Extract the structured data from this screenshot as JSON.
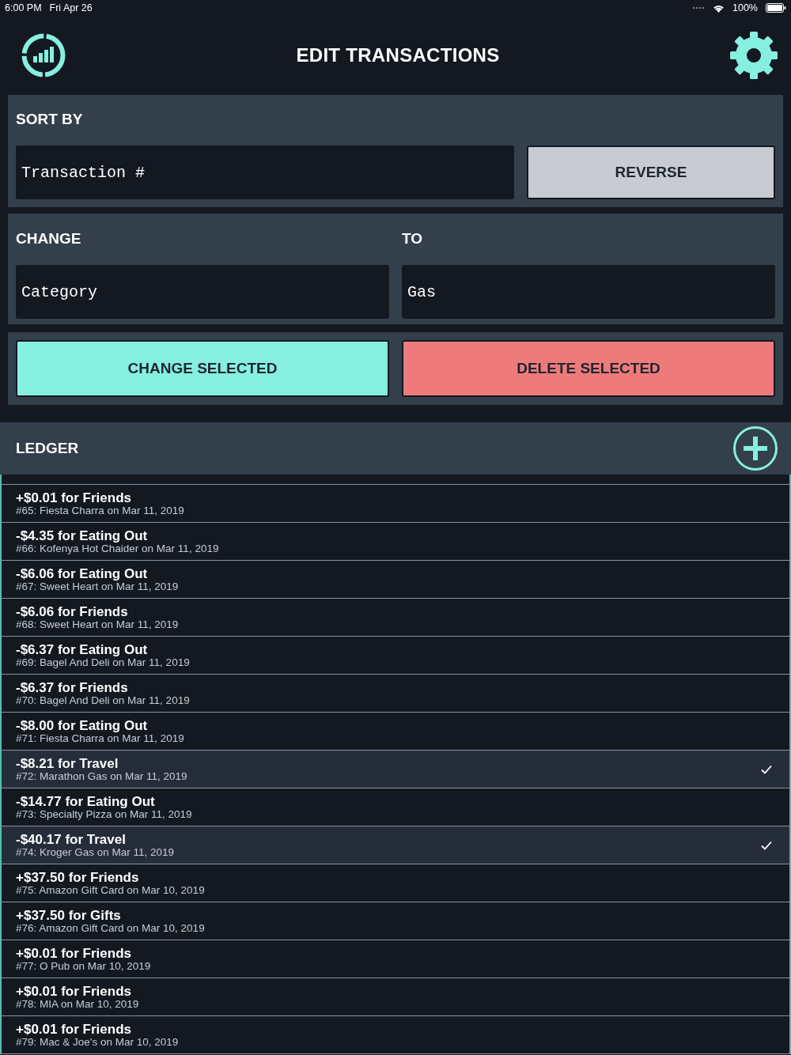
{
  "status_bar": {
    "time": "6:00 PM",
    "date": "Fri Apr 26",
    "battery": "100%"
  },
  "header": {
    "title": "EDIT TRANSACTIONS"
  },
  "sort": {
    "label": "SORT BY",
    "value": "Transaction #",
    "button": "REVERSE"
  },
  "change": {
    "label": "CHANGE",
    "field": "Category",
    "to_label": "TO",
    "to_value": "Gas"
  },
  "actions": [
    {
      "kind": "change",
      "label": "CHANGE SELECTED"
    },
    {
      "kind": "delete",
      "label": "DELETE SELECTED"
    }
  ],
  "ledger": {
    "title": "LEDGER",
    "rows": [
      {
        "title": "+$0.01 for Friends",
        "detail": "#65: Fiesta Charra on Mar 11, 2019",
        "selected": false
      },
      {
        "title": "-$4.35 for Eating Out",
        "detail": "#66: Kofenya Hot Chaider on Mar 11, 2019",
        "selected": false
      },
      {
        "title": "-$6.06 for Eating Out",
        "detail": "#67: Sweet Heart on Mar 11, 2019",
        "selected": false
      },
      {
        "title": "-$6.06 for Friends",
        "detail": "#68: Sweet Heart on Mar 11, 2019",
        "selected": false
      },
      {
        "title": "-$6.37 for Eating Out",
        "detail": "#69: Bagel And Deli on Mar 11, 2019",
        "selected": false
      },
      {
        "title": "-$6.37 for Friends",
        "detail": "#70: Bagel And Deli on Mar 11, 2019",
        "selected": false
      },
      {
        "title": "-$8.00 for Eating Out",
        "detail": "#71: Fiesta Charra on Mar 11, 2019",
        "selected": false
      },
      {
        "title": "-$8.21 for Travel",
        "detail": "#72: Marathon Gas on Mar 11, 2019",
        "selected": true
      },
      {
        "title": "-$14.77 for Eating Out",
        "detail": "#73: Specialty Pizza on Mar 11, 2019",
        "selected": false
      },
      {
        "title": "-$40.17 for Travel",
        "detail": "#74: Kroger Gas on Mar 11, 2019",
        "selected": true
      },
      {
        "title": "+$37.50 for Friends",
        "detail": "#75: Amazon Gift Card on Mar 10, 2019",
        "selected": false
      },
      {
        "title": "+$37.50 for Gifts",
        "detail": "#76: Amazon Gift Card on Mar 10, 2019",
        "selected": false
      },
      {
        "title": "+$0.01 for Friends",
        "detail": "#77: O Pub on Mar 10, 2019",
        "selected": false
      },
      {
        "title": "+$0.01 for Friends",
        "detail": "#78: MIA on Mar 10, 2019",
        "selected": false
      },
      {
        "title": "+$0.01 for Friends",
        "detail": "#79: Mac & Joe's on Mar 10, 2019",
        "selected": false
      }
    ]
  }
}
